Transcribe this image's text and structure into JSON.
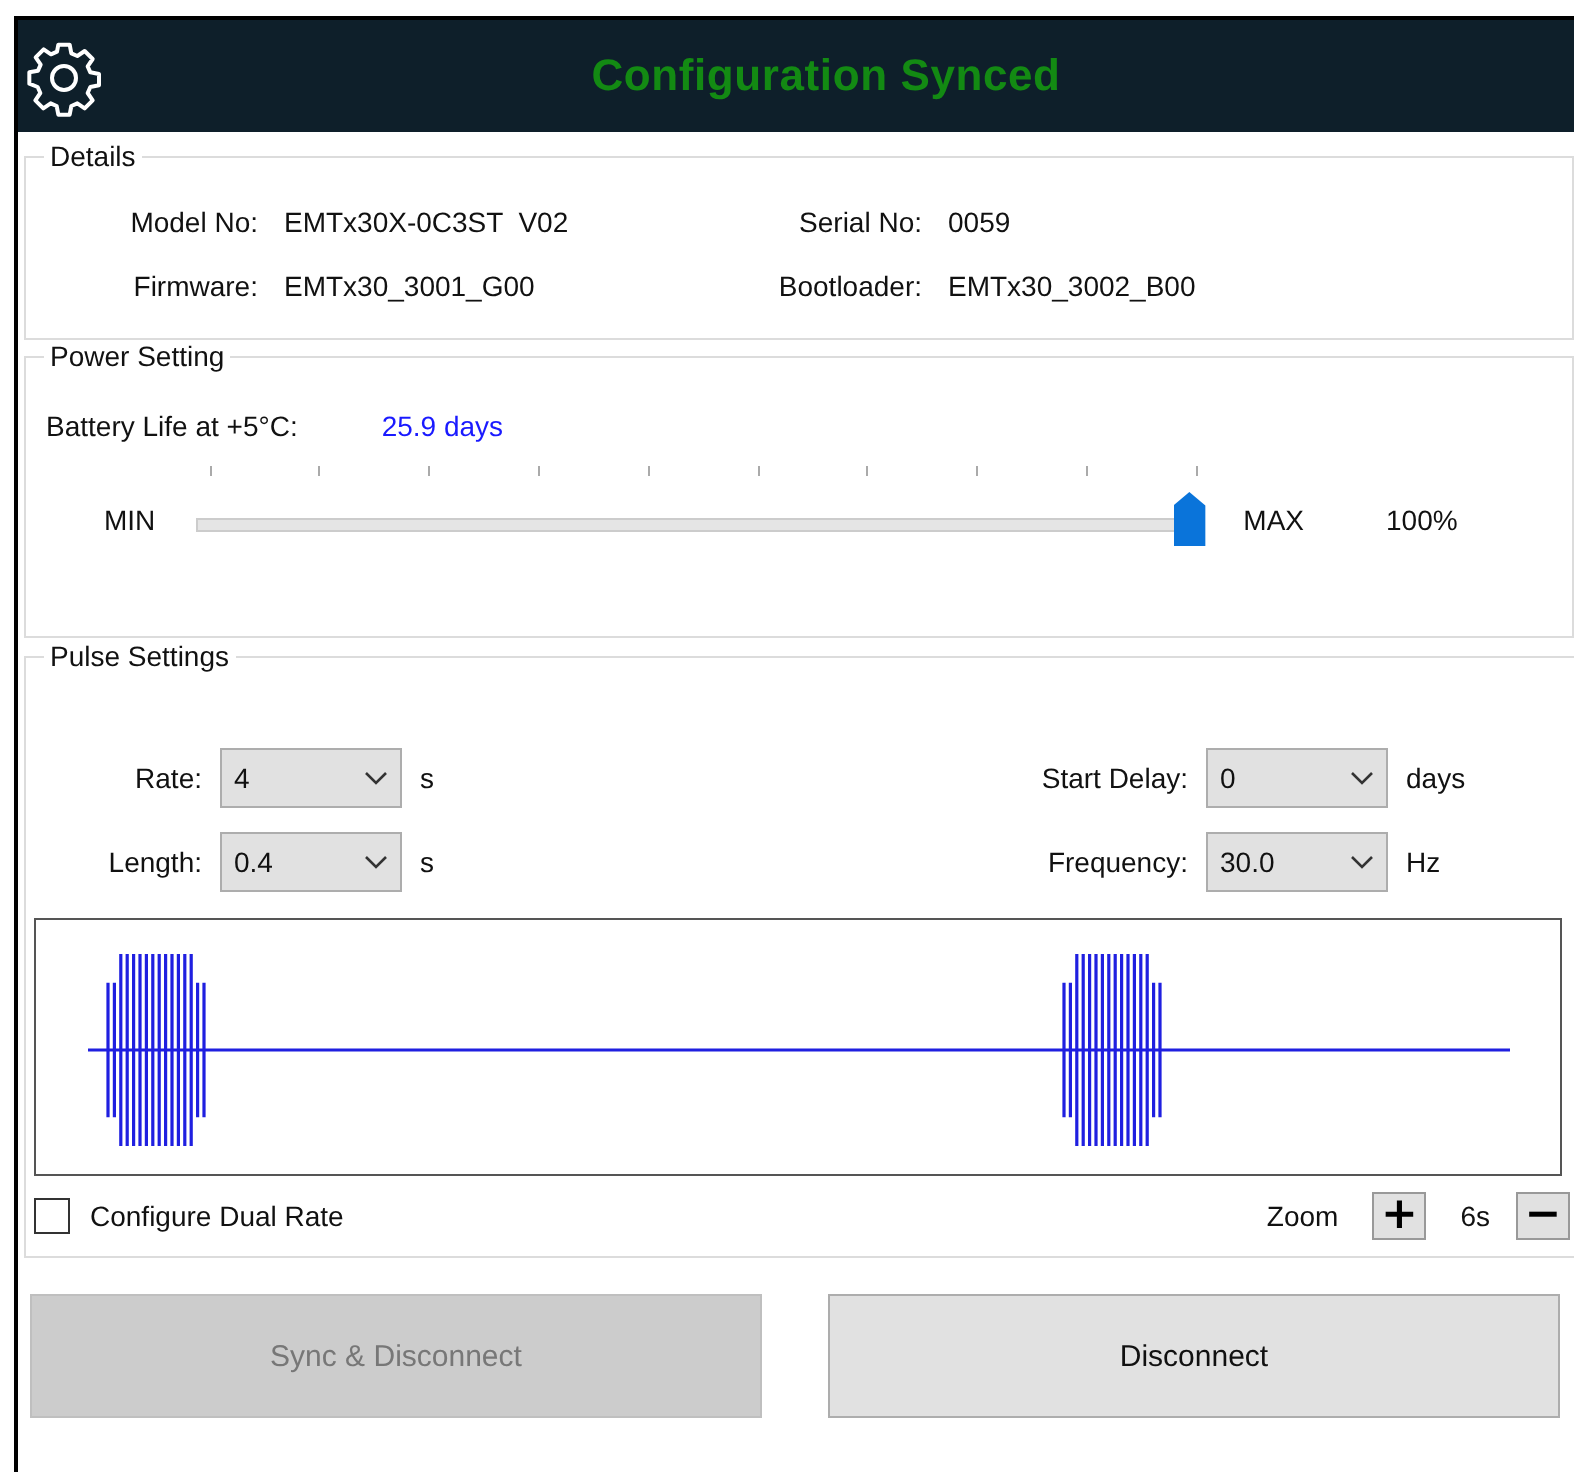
{
  "header": {
    "title": "Configuration Synced"
  },
  "details": {
    "title": "Details",
    "fields": [
      {
        "label": "Model No:",
        "value": "EMTx30X-0C3ST  V02"
      },
      {
        "label": "Serial No:",
        "value": "0059"
      },
      {
        "label": "Firmware:",
        "value": "EMTx30_3001_G00"
      },
      {
        "label": "Bootloader:",
        "value": "EMTx30_3002_B00"
      }
    ]
  },
  "power": {
    "title": "Power Setting",
    "battery_label": "Battery Life at +5°C:",
    "battery_value": "25.9 days",
    "min_label": "MIN",
    "max_label": "MAX",
    "level": 1.0,
    "reading": "100%"
  },
  "pulse": {
    "title": "Pulse Settings",
    "combos": [
      {
        "label": "Rate:",
        "value": "4",
        "unit": "s"
      },
      {
        "label": "Start Delay:",
        "value": "0",
        "unit": "days"
      },
      {
        "label": "Length:",
        "value": "0.4",
        "unit": "s"
      },
      {
        "label": "Frequency:",
        "value": "30.0",
        "unit": "Hz"
      }
    ],
    "dual_rate": {
      "label": "Configure Dual Rate",
      "checked": false
    },
    "zoom": {
      "label": "Zoom",
      "plus": "+",
      "value": "6s",
      "minus": "−"
    }
  },
  "buttons": [
    {
      "label": "Sync & Disconnect",
      "disabled": true
    },
    {
      "label": "Disconnect",
      "disabled": false
    }
  ]
}
